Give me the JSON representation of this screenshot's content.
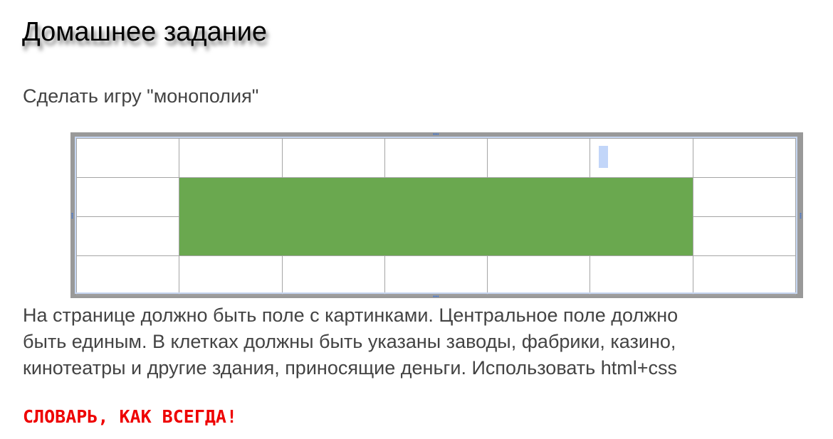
{
  "title": "Домашнее задание",
  "subtitle": "Сделать игру \"монополия\"",
  "board": {
    "rows": 4,
    "columns": 7,
    "center_color": "#6aa84f",
    "border_color": "#a5a5a5",
    "frame_color": "#999999"
  },
  "description_lines": [
    "На странице должно быть поле с картинками. Центральное поле должно",
    "быть единым. В клетках должны быть указаны заводы, фабрики, казино,",
    "кинотеатры и другие здания, приносящие деньги. Использовать html+css"
  ],
  "warning": "СЛОВАРЬ, КАК ВСЕГДА!",
  "warning_color": "#ee0000"
}
